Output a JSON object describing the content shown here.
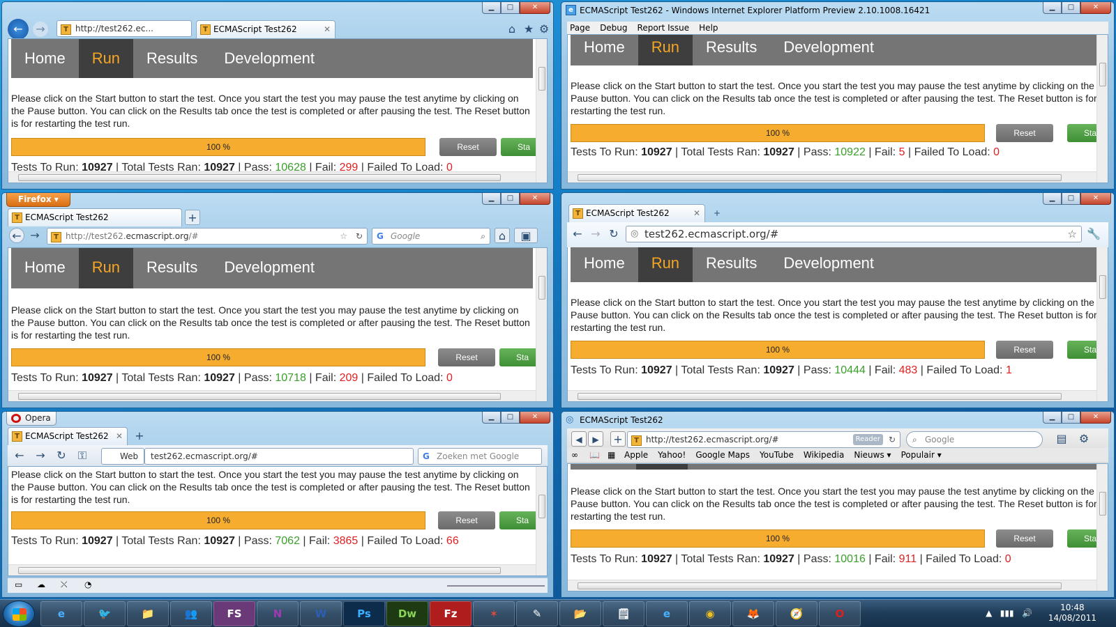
{
  "common": {
    "nav": [
      "Home",
      "Run",
      "Results",
      "Development"
    ],
    "active_nav": "Run",
    "description": "Please click on the Start button to start the test. Once you start the test you may pause the test anytime by clicking on the Pause button. You can click on the Results tab once the test is completed or after pausing the test. The Reset button is for restarting the test run.",
    "progress": "100 %",
    "progress_value": 100,
    "reset_label": "Reset",
    "start_label": "Sta",
    "labels": {
      "tests_to_run": "Tests To Run:",
      "total_ran": "Total Tests Ran:",
      "pass": "Pass:",
      "fail": "Fail:",
      "failed_to_load": "Failed To Load:"
    },
    "tab_title": "ECMAScript Test262",
    "favicon": "T"
  },
  "windows": {
    "ie9": {
      "address": "http://test262.ec...",
      "tab": "ECMAScript Test262",
      "stats": {
        "to_run": "10927",
        "ran": "10927",
        "pass": "10628",
        "fail": "299",
        "ftl": "0"
      }
    },
    "ie10": {
      "title": "ECMAScript Test262 - Windows Internet Explorer Platform Preview 2.10.1008.16421",
      "menu": [
        "Page",
        "Debug",
        "Report Issue",
        "Help"
      ],
      "stats": {
        "to_run": "10927",
        "ran": "10927",
        "pass": "10922",
        "fail": "5",
        "ftl": "0"
      }
    },
    "firefox": {
      "app_label": "Firefox",
      "tab": "ECMAScript Test262",
      "address_pre": "http://test262.",
      "address_domain": "ecmascript.org",
      "address_post": "/#",
      "search_placeholder": "Google",
      "stats": {
        "to_run": "10927",
        "ran": "10927",
        "pass": "10718",
        "fail": "209",
        "ftl": "0"
      }
    },
    "chrome": {
      "tab": "ECMAScript Test262",
      "address": "test262.ecmascript.org/#",
      "stats": {
        "to_run": "10927",
        "ran": "10927",
        "pass": "10444",
        "fail": "483",
        "ftl": "1"
      }
    },
    "opera": {
      "app_label": "Opera",
      "tab": "ECMAScript Test262",
      "web_label": "Web",
      "address": "test262.ecmascript.org/#",
      "search_placeholder": "Zoeken met Google",
      "stats": {
        "to_run": "10927",
        "ran": "10927",
        "pass": "7062",
        "fail": "3865",
        "ftl": "66"
      }
    },
    "safari": {
      "title": "ECMAScript Test262",
      "address": "http://test262.ecmascript.org/#",
      "reader_label": "Reader",
      "search_placeholder": "Google",
      "bookmarks": [
        "Apple",
        "Yahoo!",
        "Google Maps",
        "YouTube",
        "Wikipedia",
        "Nieuws ▾",
        "Populair ▾"
      ],
      "stats": {
        "to_run": "10927",
        "ran": "10927",
        "pass": "10016",
        "fail": "911",
        "ftl": "0"
      }
    }
  },
  "taskbar": {
    "time": "10:48",
    "date": "14/08/2011",
    "apps": [
      "e",
      "🐦",
      "📁",
      "👥",
      "FS",
      "N",
      "W",
      "Ps",
      "Dw",
      "Fz",
      "✶",
      "✎",
      "📂",
      "🗒",
      "e",
      "◉",
      "🦊",
      "🧭",
      "O"
    ]
  },
  "colors": {
    "accent_orange": "#f5a623",
    "nav_bg": "#757575",
    "pass": "#3a9e2a",
    "fail": "#e02020",
    "progress": "#f5ac2f"
  }
}
